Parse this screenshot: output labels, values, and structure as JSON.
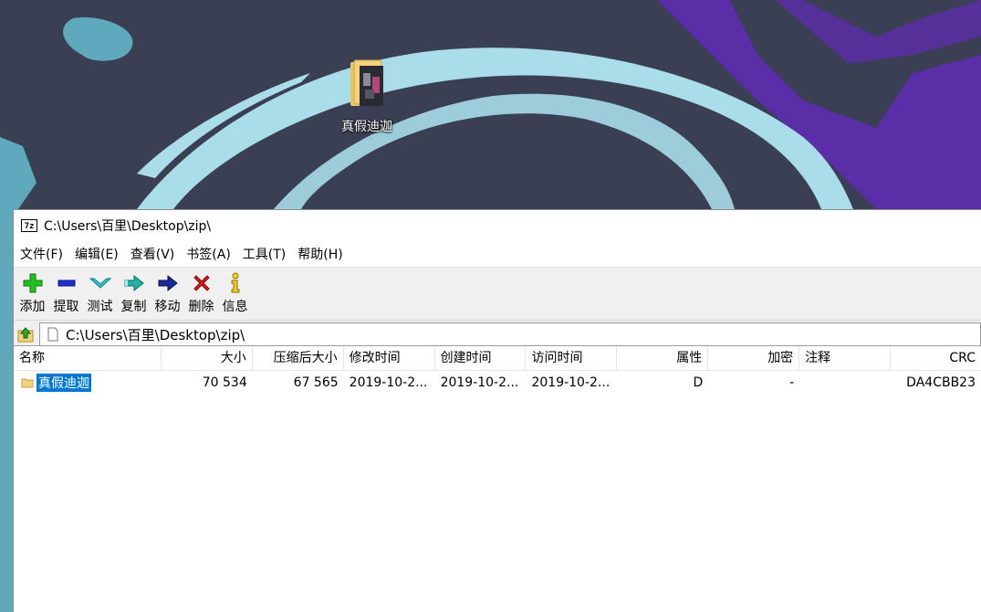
{
  "desktop": {
    "icon_label": "真假迪迦",
    "colors": {
      "background": "#3a3f53",
      "swirl": "#a9dde9",
      "purple": "#5a2ea6",
      "teal": "#5fa9bd"
    }
  },
  "window": {
    "title": "C:\\Users\\百里\\Desktop\\zip\\",
    "app_icon_text": "7z",
    "menus": [
      "文件(F)",
      "编辑(E)",
      "查看(V)",
      "书签(A)",
      "工具(T)",
      "帮助(H)"
    ],
    "toolbar": [
      {
        "label": "添加",
        "icon": "add-icon"
      },
      {
        "label": "提取",
        "icon": "extract-icon"
      },
      {
        "label": "测试",
        "icon": "test-icon"
      },
      {
        "label": "复制",
        "icon": "copy-icon"
      },
      {
        "label": "移动",
        "icon": "move-icon"
      },
      {
        "label": "删除",
        "icon": "delete-icon"
      },
      {
        "label": "信息",
        "icon": "info-icon"
      }
    ],
    "address": "C:\\Users\\百里\\Desktop\\zip\\",
    "columns": [
      "名称",
      "大小",
      "压缩后大小",
      "修改时间",
      "创建时间",
      "访问时间",
      "属性",
      "加密",
      "注释",
      "CRC"
    ],
    "rows": [
      {
        "name": "真假迪迦",
        "size": "70 534",
        "packed": "67 565",
        "modified": "2019-10-2...",
        "created": "2019-10-2...",
        "accessed": "2019-10-2...",
        "attr": "D",
        "encrypted": "-",
        "comment": "",
        "crc": "DA4CBB23"
      }
    ]
  }
}
